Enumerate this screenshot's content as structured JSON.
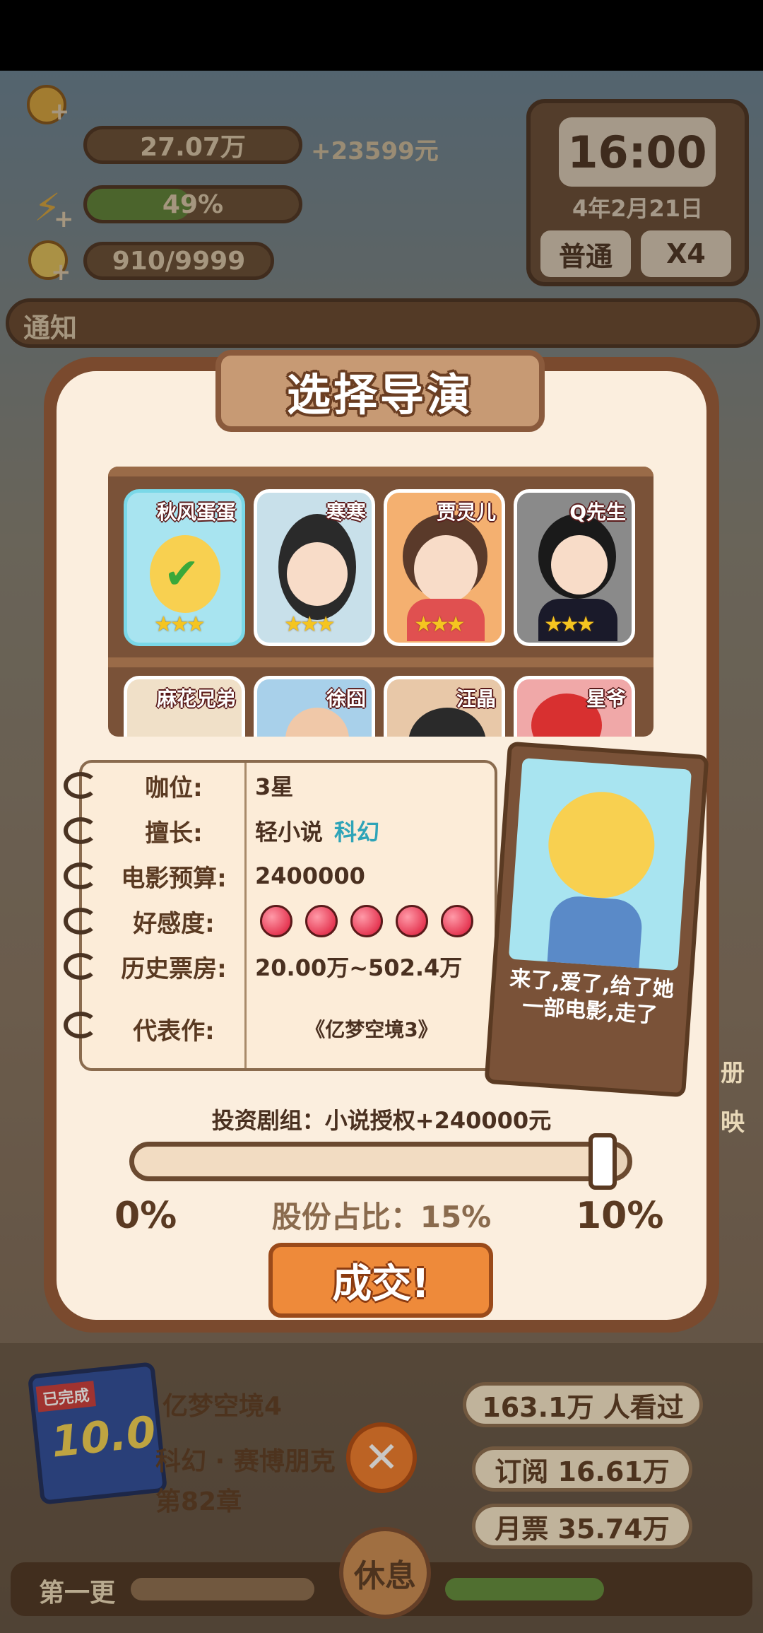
{
  "hud": {
    "money": "27.07万",
    "income": "+23599元",
    "energy": "49%",
    "energy_level": 0.49,
    "ideas": "910/9999",
    "notice_label": "通知"
  },
  "clock": {
    "time": "16:00",
    "date": "4年2月21日",
    "mode": "普通",
    "speed": "X4"
  },
  "dialog": {
    "title": "选择导演",
    "directors": [
      {
        "name": "秋风蛋蛋",
        "stars": "★★★",
        "selected": true
      },
      {
        "name": "寒寒",
        "stars": "★★★"
      },
      {
        "name": "贾灵儿",
        "stars": "★★★"
      },
      {
        "name": "Q先生",
        "stars": "★★★"
      },
      {
        "name": "麻花兄弟"
      },
      {
        "name": "徐囧"
      },
      {
        "name": "汪晶"
      },
      {
        "name": "星爷"
      }
    ],
    "info": {
      "rank_label": "咖位:",
      "rank_value": "3星",
      "skill_label": "擅长:",
      "skill_value1": "轻小说",
      "skill_value2": "科幻",
      "budget_label": "电影预算:",
      "budget_value": "2400000",
      "affinity_label": "好感度:",
      "affinity_hearts": 5,
      "boxoffice_label": "历史票房:",
      "boxoffice_value": "20.00万~502.4万",
      "work_label": "代表作:",
      "work_value": "《亿梦空境3》"
    },
    "quote": "来了,爱了,给了她一部电影,走了",
    "invest_text": "投资剧组：小说授权+240000元",
    "slider_value": 0.95,
    "slider_min": "0%",
    "slider_max": "10%",
    "share_text": "股份占比：15%",
    "deal_button": "成交!"
  },
  "bottom": {
    "book_title": "亿梦空境4",
    "book_score": "10.0",
    "book_badge": "已完成",
    "genre": "科幻 · 赛博朋克",
    "chapter": "第82章",
    "viewers": "163.1万 人看过",
    "subscribe": "订阅 16.61万",
    "monthly": "月票 35.74万",
    "rest_button": "休息",
    "first_update": "第一更",
    "right_labels": [
      "册",
      "映"
    ]
  },
  "colors": {
    "accent": "#ee8a3a",
    "teal": "#2ea4b8",
    "brown": "#7a4a2e"
  }
}
